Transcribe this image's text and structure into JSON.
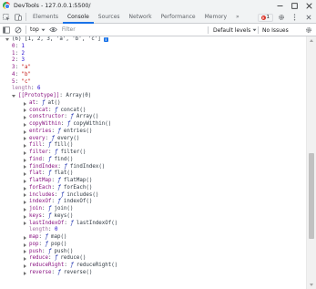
{
  "window": {
    "title": "DevTools - 127.0.0.1:5500/",
    "controls": [
      "minimize-icon",
      "maximize-icon",
      "close-icon"
    ]
  },
  "tabs": [
    {
      "label": "Elements",
      "active": false
    },
    {
      "label": "Console",
      "active": true
    },
    {
      "label": "Sources",
      "active": false
    },
    {
      "label": "Network",
      "active": false
    },
    {
      "label": "Performance",
      "active": false
    },
    {
      "label": "Memory",
      "active": false
    }
  ],
  "more_tabs": "»",
  "error_badge": {
    "count": "1"
  },
  "toolbar": {
    "context": "top",
    "filter_placeholder": "Filter",
    "levels": "Default levels",
    "issues": "No Issues"
  },
  "console": {
    "header": "(6) [1, 2, 3, 'a', 'b', 'c']",
    "entries": [
      {
        "key": "0",
        "value": "1",
        "kind": "num"
      },
      {
        "key": "1",
        "value": "2",
        "kind": "num"
      },
      {
        "key": "2",
        "value": "3",
        "kind": "num"
      },
      {
        "key": "3",
        "value": "\"a\"",
        "kind": "str"
      },
      {
        "key": "4",
        "value": "\"b\"",
        "kind": "str"
      },
      {
        "key": "5",
        "value": "\"c\"",
        "kind": "str"
      }
    ],
    "length_key": "length",
    "length_value": "6",
    "prototype_label": "[[Prototype]]",
    "prototype_value": "Array(0)",
    "methods": [
      {
        "name": "at",
        "fn": "at()",
        "expandable": true
      },
      {
        "name": "concat",
        "fn": "concat()",
        "expandable": true
      },
      {
        "name": "constructor",
        "fn": "Array()",
        "expandable": true
      },
      {
        "name": "copyWithin",
        "fn": "copyWithin()",
        "expandable": true
      },
      {
        "name": "entries",
        "fn": "entries()",
        "expandable": true
      },
      {
        "name": "every",
        "fn": "every()",
        "expandable": true
      },
      {
        "name": "fill",
        "fn": "fill()",
        "expandable": true
      },
      {
        "name": "filter",
        "fn": "filter()",
        "expandable": true
      },
      {
        "name": "find",
        "fn": "find()",
        "expandable": true
      },
      {
        "name": "findIndex",
        "fn": "findIndex()",
        "expandable": true
      },
      {
        "name": "flat",
        "fn": "flat()",
        "expandable": true
      },
      {
        "name": "flatMap",
        "fn": "flatMap()",
        "expandable": true
      },
      {
        "name": "forEach",
        "fn": "forEach()",
        "expandable": true
      },
      {
        "name": "includes",
        "fn": "includes()",
        "expandable": true
      },
      {
        "name": "indexOf",
        "fn": "indexOf()",
        "expandable": true
      },
      {
        "name": "join",
        "fn": "join()",
        "expandable": true
      },
      {
        "name": "keys",
        "fn": "keys()",
        "expandable": true
      },
      {
        "name": "lastIndexOf",
        "fn": "lastIndexOf()",
        "expandable": true
      },
      {
        "name": "length",
        "value": "0",
        "expandable": false
      },
      {
        "name": "map",
        "fn": "map()",
        "expandable": true
      },
      {
        "name": "pop",
        "fn": "pop()",
        "expandable": true
      },
      {
        "name": "push",
        "fn": "push()",
        "expandable": true
      },
      {
        "name": "reduce",
        "fn": "reduce()",
        "expandable": true
      },
      {
        "name": "reduceRight",
        "fn": "reduceRight()",
        "expandable": true
      },
      {
        "name": "reverse",
        "fn": "reverse()",
        "expandable": true
      }
    ],
    "fn_prefix": "ƒ"
  },
  "colors": {
    "accent": "#1a73e8",
    "key": "#881280",
    "number": "#1c00cf",
    "string": "#c41a16",
    "error": "#d93025"
  }
}
